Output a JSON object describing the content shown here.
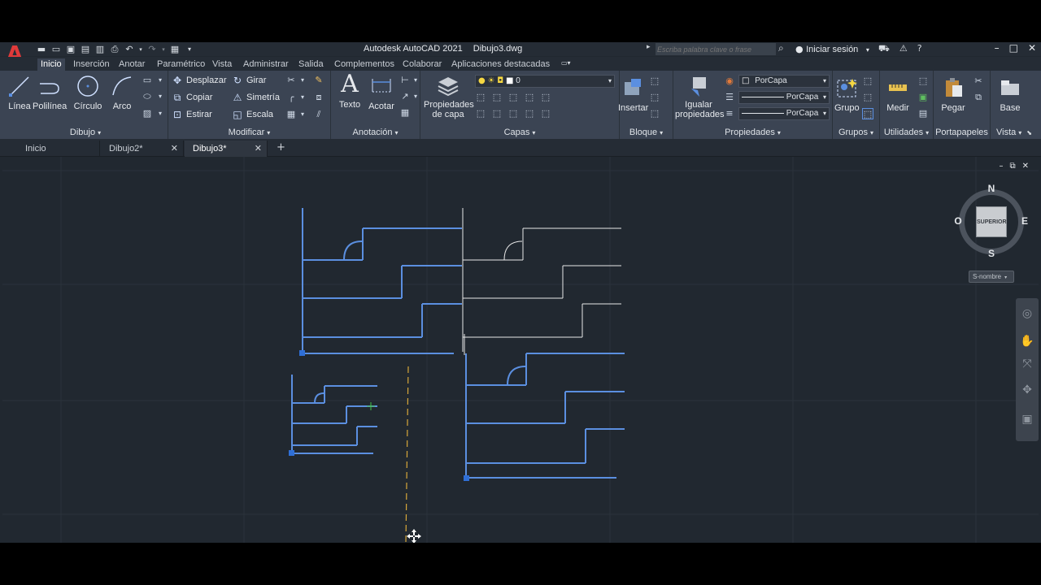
{
  "app": {
    "logo_letter": "A",
    "title": "Autodesk AutoCAD 2021",
    "filename": "Dibujo3.dwg",
    "search_placeholder": "Escriba palabra clave o frase",
    "signin_label": "Iniciar sesión"
  },
  "ribbon_tabs": [
    {
      "label": "Inicio",
      "active": true
    },
    {
      "label": "Inserción"
    },
    {
      "label": "Anotar"
    },
    {
      "label": "Paramétrico"
    },
    {
      "label": "Vista"
    },
    {
      "label": "Administrar"
    },
    {
      "label": "Salida"
    },
    {
      "label": "Complementos"
    },
    {
      "label": "Colaborar"
    },
    {
      "label": "Aplicaciones destacadas"
    }
  ],
  "panels": {
    "dibujo": {
      "label": "Dibujo",
      "linea": "Línea",
      "polilinea": "Polilínea",
      "circulo": "Círculo",
      "arco": "Arco"
    },
    "modificar": {
      "label": "Modificar",
      "desplazar": "Desplazar",
      "girar": "Girar",
      "copiar": "Copiar",
      "simetria": "Simetría",
      "estirar": "Estirar",
      "escala": "Escala"
    },
    "anotacion": {
      "label": "Anotación",
      "texto": "Texto",
      "acotar": "Acotar"
    },
    "capas": {
      "label": "Capas",
      "propiedades_1": "Propiedades",
      "propiedades_2": "de capa",
      "current_layer": "0"
    },
    "bloque": {
      "label": "Bloque",
      "insertar": "Insertar"
    },
    "propiedades": {
      "label": "Propiedades",
      "igualar_1": "Igualar",
      "igualar_2": "propiedades",
      "color": "PorCapa",
      "linetype": "PorCapa",
      "lineweight": "PorCapa"
    },
    "grupos": {
      "label": "Grupos",
      "grupo": "Grupo"
    },
    "utilidades": {
      "label": "Utilidades",
      "medir": "Medir"
    },
    "portapapeles": {
      "label": "Portapapeles",
      "pegar": "Pegar"
    },
    "vista": {
      "label": "Vista",
      "base": "Base"
    }
  },
  "doc_tabs": [
    {
      "label": "Inicio"
    },
    {
      "label": "Dibujo2*"
    },
    {
      "label": "Dibujo3*",
      "active": true
    }
  ],
  "viewcube": {
    "face": "SUPERIOR",
    "north": "N",
    "south": "S",
    "east": "E",
    "west": "O",
    "wcs": "S-nombre"
  },
  "colors": {
    "selected_lines": "#5b8fe0",
    "plain_lines": "#e8e8e8",
    "grip": "#2f6fd6",
    "centerline": "#d8a83a",
    "background": "#212830"
  }
}
